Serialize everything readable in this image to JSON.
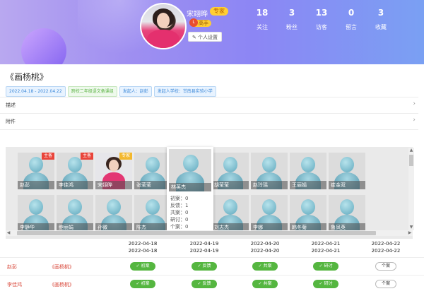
{
  "profile": {
    "name": "宋翊晔",
    "role_badge": "专家",
    "level_badge": "高手",
    "level_icon": "L",
    "settings_label": "个人设置"
  },
  "stats": [
    {
      "num": "18",
      "label": "关注"
    },
    {
      "num": "3",
      "label": "粉丝"
    },
    {
      "num": "13",
      "label": "访客"
    },
    {
      "num": "0",
      "label": "留言"
    },
    {
      "num": "3",
      "label": "收藏"
    }
  ],
  "lesson": {
    "title": "《画杨桃》",
    "tags": [
      {
        "text": "2022.04.18 - 2022.04.22",
        "color": "blue"
      },
      {
        "text": "跨校二年级语文备课组",
        "color": "green"
      },
      {
        "text": "发起人：赵彭",
        "color": "blue"
      },
      {
        "text": "发起人学校：甘南县实验小学",
        "color": "blue"
      }
    ],
    "rows": [
      {
        "label": "描述"
      },
      {
        "label": "附件"
      }
    ]
  },
  "gallery": {
    "row1": [
      {
        "name": "赵彭",
        "mark": "主备",
        "mark_type": "host"
      },
      {
        "name": "李佳鸿",
        "mark": "主备",
        "mark_type": "host"
      },
      {
        "name": "宋翊晔",
        "mark": "专家",
        "mark_type": "expert",
        "photo": true
      },
      {
        "name": "张莹莹",
        "mark": "",
        "mark_type": ""
      },
      {
        "name": "",
        "mark": "",
        "mark_type": ""
      },
      {
        "name": "胡莹莹",
        "mark": "",
        "mark_type": ""
      },
      {
        "name": "赵玲瑶",
        "mark": "",
        "mark_type": ""
      },
      {
        "name": "王丽娟",
        "mark": "",
        "mark_type": ""
      },
      {
        "name": "崔金双",
        "mark": "",
        "mark_type": ""
      }
    ],
    "row2": [
      {
        "name": "李静华"
      },
      {
        "name": "鲍丽娟"
      },
      {
        "name": "孙微"
      },
      {
        "name": "陈杰"
      },
      {
        "name": ""
      },
      {
        "name": "刘志杰"
      },
      {
        "name": "李娜"
      },
      {
        "name": "韩冬菊"
      },
      {
        "name": "鲁凤英"
      }
    ],
    "popup": {
      "name": "林英杰",
      "lines": [
        "初案：0",
        "反馈：1",
        "共案：0",
        "研讨：0",
        "个案：0"
      ]
    }
  },
  "schedule": {
    "dates": [
      {
        "start": "2022-04-18",
        "end": "2022-04-18"
      },
      {
        "start": "2022-04-19",
        "end": "2022-04-19"
      },
      {
        "start": "2022-04-20",
        "end": "2022-04-20"
      },
      {
        "start": "2022-04-21",
        "end": "2022-04-21"
      },
      {
        "start": "2022-04-22",
        "end": "2022-04-22"
      }
    ],
    "rows": [
      {
        "name": "赵彭",
        "title": "《画杨桃》",
        "stages": [
          "初案",
          "反馈",
          "共案",
          "研讨",
          "个案"
        ]
      },
      {
        "name": "李佳鸿",
        "title": "《画杨桃》",
        "stages": [
          "初案",
          "反馈",
          "共案",
          "研讨",
          "个案"
        ]
      }
    ]
  }
}
